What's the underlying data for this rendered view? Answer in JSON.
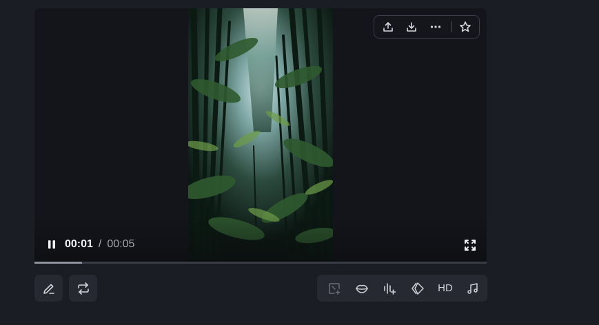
{
  "player": {
    "current_time": "00:01",
    "separator": "/",
    "duration": "00:05",
    "progress_fraction": 0.105
  },
  "top_toolbar": {
    "icons": [
      "share-icon",
      "download-icon",
      "more-icon",
      "star-icon"
    ]
  },
  "bottom_left": {
    "icons": [
      "edit-icon",
      "repeat-icon"
    ]
  },
  "tools": {
    "icons": [
      "add-frame-icon",
      "lips-icon",
      "audio-sparkle-icon",
      "diamond-icon",
      "hd-label",
      "music-note-icon"
    ],
    "hd_label": "HD"
  },
  "colors": {
    "background": "#1b1d24",
    "player_bg": "#14151a",
    "button_bg": "#272932",
    "progress_track": "#3a3c45",
    "progress_fill": "#8f929c"
  }
}
